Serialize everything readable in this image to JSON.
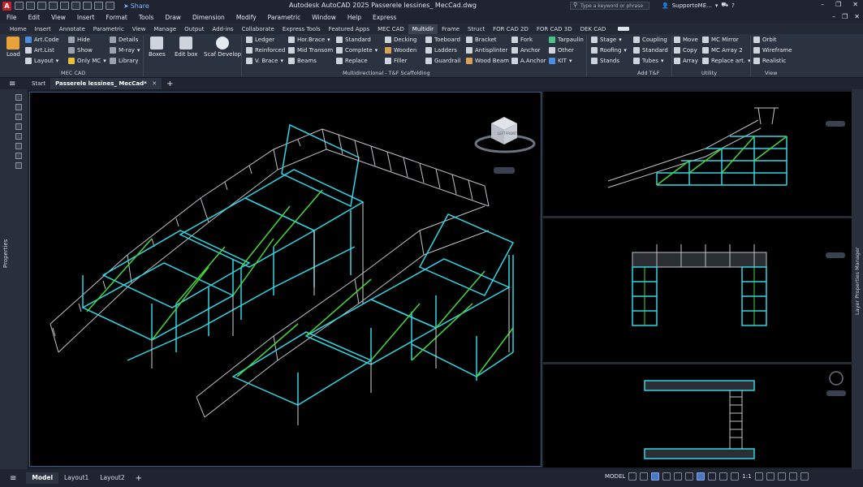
{
  "window": {
    "title": "Autodesk AutoCAD 2025    Passerele lessines_ MecCad.dwg",
    "app_icon_letter": "A",
    "share_label": "Share",
    "search_placeholder": "Type a keyword or phrase",
    "user_name": "SupportoME...",
    "controls": [
      "–",
      "❐",
      "✕"
    ]
  },
  "menu": {
    "items": [
      "File",
      "Edit",
      "View",
      "Insert",
      "Format",
      "Tools",
      "Draw",
      "Dimension",
      "Modify",
      "Parametric",
      "Window",
      "Help",
      "Express"
    ],
    "right_controls": [
      "–",
      "❐",
      "✕"
    ]
  },
  "ribbon_tabs": {
    "items": [
      "Home",
      "Insert",
      "Annotate",
      "Parametric",
      "View",
      "Manage",
      "Output",
      "Add-ins",
      "Collaborate",
      "Express Tools",
      "Featured Apps",
      "MEC CAD",
      "Multidir",
      "Frame",
      "Struct",
      "FOR CAD 2D",
      "FOR CAD 3D",
      "DEK CAD"
    ],
    "active_index": 12
  },
  "ribbon": {
    "load": "Load",
    "mec_cad": {
      "label": "MEC CAD",
      "col1": [
        "Art.Code",
        "Art.List",
        "Layout"
      ],
      "col2": [
        "Hide",
        "Show",
        "Only MC"
      ],
      "col3": [
        "Details",
        "M-ray",
        "Library"
      ]
    },
    "boxes": "Boxes",
    "edit_box": "Edit box",
    "scaf_develop": "Scaf Develop",
    "multi": {
      "label": "Multidirectional - T&F Scaffolding",
      "col1": [
        "Ledger",
        "Reinforced",
        "V. Brace"
      ],
      "col2": [
        "Hor.Brace",
        "Mid Transom",
        "Beams"
      ],
      "col3": [
        "Standard",
        "Complete",
        "Replace"
      ],
      "col4": [
        "Decking",
        "Wooden",
        "Filler"
      ],
      "col5": [
        "Toeboard",
        "Ladders",
        "Guardrail"
      ],
      "col6": [
        "Bracket",
        "Antisplinter",
        "Wood Beam"
      ],
      "col7": [
        "Fork",
        "Anchor",
        "A.Anchor"
      ],
      "col8": [
        "Tarpaulin",
        "Other",
        "KIT"
      ]
    },
    "add_tf": {
      "label": "Add T&F",
      "col1": [
        "Stage",
        "Roofing",
        "Stands"
      ],
      "col2": [
        "Coupling",
        "Standard",
        "Tubes"
      ]
    },
    "utility": {
      "label": "Utility",
      "col1": [
        "Move",
        "Copy",
        "Array"
      ],
      "col2": [
        "MC Mirror",
        "MC Array 2",
        "Replace art."
      ]
    },
    "view": {
      "label": "View",
      "col1": [
        "Orbit",
        "Wireframe",
        "Realistic"
      ]
    }
  },
  "doc_tabs": {
    "start": "Start",
    "active": "Passerele lessines_ MecCad*",
    "close": "✕",
    "plus": "+"
  },
  "palettes": {
    "left": "Properties",
    "right": "Layer Properties Manager"
  },
  "viewcube": {
    "top": "TOP",
    "front": "FRONT",
    "left": "LEFT"
  },
  "status": {
    "layout_tabs": [
      "Model",
      "Layout1",
      "Layout2"
    ],
    "active_layout": 0,
    "model_label": "MODEL",
    "scale": "1:1"
  },
  "colors": {
    "structure": "#bfc3c8",
    "ledger": "#2fd8e6",
    "brace": "#49d63a",
    "background": "#000000",
    "ribbon": "#2c3340"
  }
}
